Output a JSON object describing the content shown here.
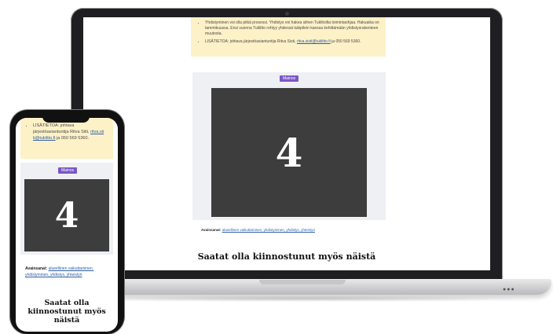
{
  "laptop": {
    "info_items": [
      "Yhdistyminen voi olla pitkä prosessi. Yhdistys voi hakea siihen Tuklitoilta toimintaohjaa. Hakuaika on tammikuussa. Ensi vuonna Tuklitto rohtyy yhdessä tukipilein kanssa kehittämään yhdistysrakenteen muutosta."
    ],
    "contact_prefix": "LISÄTIETOA: johtava järjestöasiantuntija Ritva Sisti,",
    "contact_email": "ritva.sisti@tuklitto.fi",
    "contact_suffix": "ja 050 569 5360.",
    "ad_label": "Mainos",
    "ad_number": "4",
    "keywords_label": "Avainsanat:",
    "keywords": "alueellinen vaikuttaminen, yhdistyminen, yhdistys, yhteistyö",
    "related_heading": "Saatat olla kiinnostunut myös näistä"
  },
  "phone": {
    "contact_prefix": "LISÄTIETOA: johtava järjestöasiantuntija Ritva Siiti,",
    "contact_email": "ritva.sii ti@tuklitto.fi",
    "contact_suffix": "ja 050 569 5360.",
    "ad_label": "Mainos",
    "ad_number": "4",
    "keywords_label": "Avainsanat:",
    "keywords": "alueellinen vaikuttaminen, yhdistyminen, yhdistys, yhteistyö",
    "related_heading": "Saatat olla kiinnostunut myös näistä"
  }
}
